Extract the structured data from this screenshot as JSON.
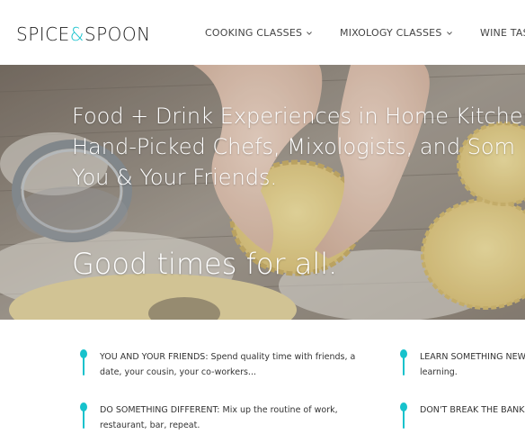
{
  "brand": {
    "name_part1": "SPICE",
    "ampersand": "&",
    "name_part2": "SPOON",
    "accent": "#16c2cc"
  },
  "nav": {
    "items": [
      {
        "label": "COOKING CLASSES",
        "icon": "chevron-down-icon"
      },
      {
        "label": "MIXOLOGY CLASSES",
        "icon": "chevron-down-icon"
      },
      {
        "label": "WINE TAS"
      }
    ]
  },
  "hero": {
    "headline_lines": [
      "Food + Drink Experiences in Home Kitchen",
      "Hand-Picked Chefs, Mixologists, and Som",
      "You & Your Friends."
    ],
    "tagline": "Good times for all."
  },
  "features": [
    {
      "text": "YOU AND YOUR FRIENDS: Spend quality time with friends, a date, your cousin, your co-workers...",
      "icon": "spoon-icon"
    },
    {
      "text": "LEARN SOMETHING NEW learning.",
      "icon": "spoon-icon"
    },
    {
      "text": "DO SOMETHING DIFFERENT: Mix up the routine of work, restaurant, bar, repeat.",
      "icon": "spoon-icon"
    },
    {
      "text": "DON'T BREAK THE BANK",
      "icon": "spoon-icon"
    }
  ]
}
